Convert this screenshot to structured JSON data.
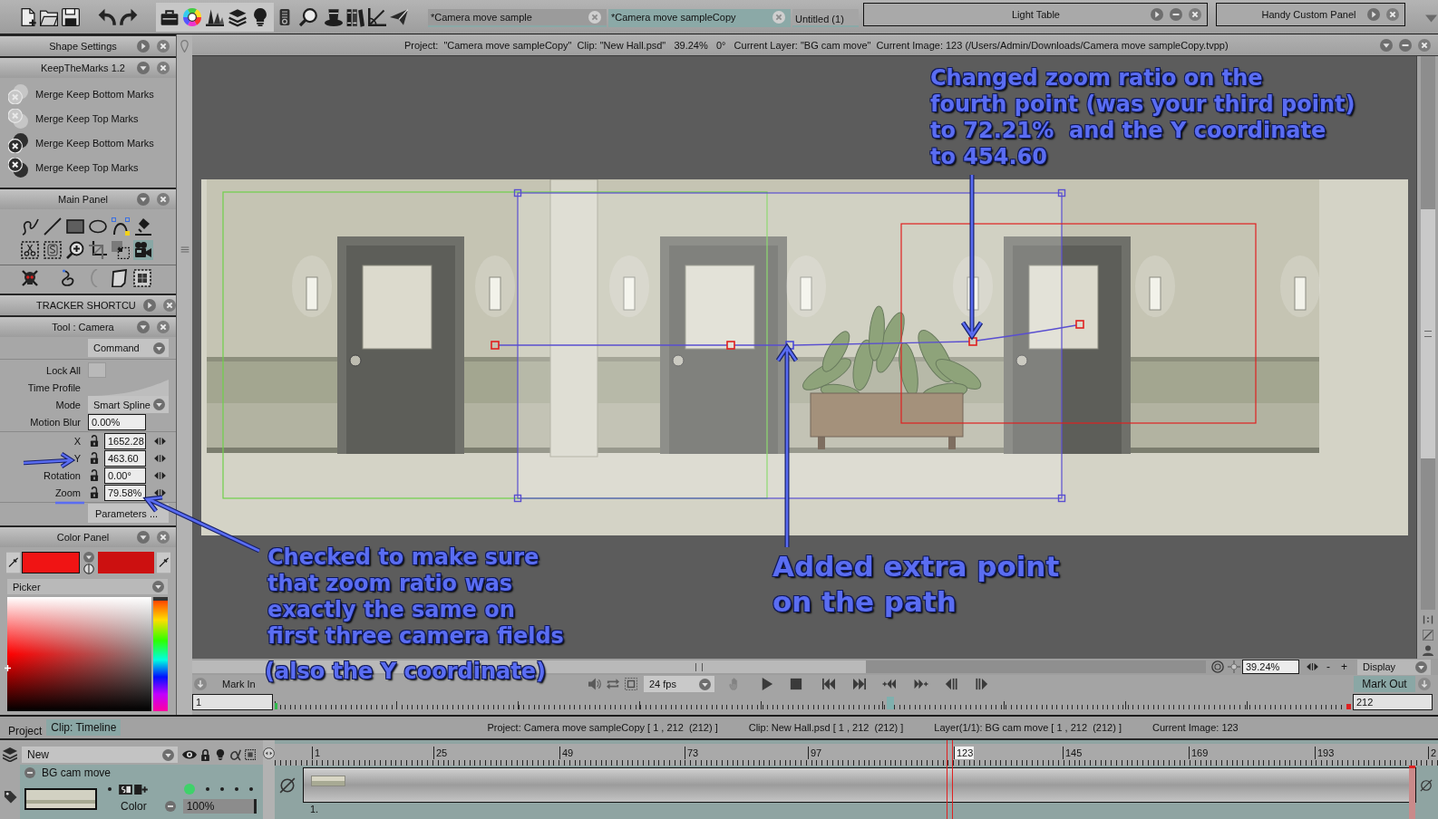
{
  "toolbar": {
    "document_tabs": [
      {
        "label": "*Camera move sample",
        "selected": false,
        "closable": true
      },
      {
        "label": "*Camera move sampleCopy",
        "selected": true,
        "closable": true
      },
      {
        "label": "Untitled (1)",
        "selected": false,
        "closable": false
      }
    ],
    "panels": [
      {
        "title": "Light Table",
        "expanded": false,
        "minimizable": true
      },
      {
        "title": "Handy Custom Panel",
        "expanded": false,
        "minimizable": false
      }
    ]
  },
  "info_bar": {
    "text": "Project:  \"Camera move sampleCopy\"  Clip: \"New Hall.psd\"   39.24%   0°   Current Layer: \"BG cam move\"  Current Image: 123 (/Users/Admin/Downloads/Camera move sampleCopy.tvpp)"
  },
  "side_panels": {
    "shape_settings": {
      "title": "Shape Settings",
      "expanded": false
    },
    "keep_the_marks": {
      "title": "KeepTheMarks 1.2",
      "expanded": true,
      "items": [
        {
          "label": "Merge Keep Bottom Marks",
          "kind": "keep_bottom",
          "disabled": true
        },
        {
          "label": "Merge Keep Top Marks",
          "kind": "keep_top",
          "disabled": true
        },
        {
          "label": "Merge Keep Bottom Marks",
          "kind": "keep_bottom",
          "disabled": false
        },
        {
          "label": "Merge Keep Top Marks",
          "kind": "keep_top",
          "disabled": false
        }
      ]
    },
    "main_panel": {
      "title": "Main Panel",
      "expanded": true,
      "tool_rows": [
        [
          {
            "kind": "freehand",
            "selected": false
          },
          {
            "kind": "line",
            "selected": false
          },
          {
            "kind": "rectangle",
            "selected": false
          },
          {
            "kind": "ellipse",
            "selected": false
          },
          {
            "kind": "spline",
            "selected": false
          },
          {
            "kind": "ink",
            "selected": false
          }
        ],
        [
          {
            "kind": "cut",
            "selected": false
          },
          {
            "kind": "stencil",
            "selected": false
          },
          {
            "kind": "zoom",
            "selected": false
          },
          {
            "kind": "crop",
            "selected": false
          },
          {
            "kind": "transform",
            "selected": false
          },
          {
            "kind": "camera",
            "selected": true
          }
        ],
        [
          {
            "kind": "skull",
            "selected": false
          },
          {
            "kind": "curl",
            "selected": false
          },
          {
            "kind": "bracket",
            "selected": false
          },
          {
            "kind": "page",
            "selected": false
          },
          {
            "kind": "stamp",
            "selected": false
          }
        ]
      ]
    },
    "tracker_shortcut": {
      "title": "TRACKER SHORTCU",
      "expanded": false
    },
    "camera_tool": {
      "title": "Tool : Camera",
      "expanded": true,
      "command": "Command",
      "lock_all": {
        "label": "Lock All",
        "checked": false
      },
      "time_profile": {
        "label": "Time Profile"
      },
      "mode": {
        "label": "Mode",
        "value": "Smart Spline"
      },
      "motion_blur": {
        "label": "Motion Blur",
        "value": "0.00%"
      },
      "fields": [
        {
          "label": "X",
          "value": "1652.28",
          "locked": false
        },
        {
          "label": "Y",
          "value": "463.60",
          "locked": false
        },
        {
          "label": "Rotation",
          "value": "0.00°",
          "locked": false
        },
        {
          "label": "Zoom",
          "value": "79.58%",
          "locked": false
        }
      ],
      "parameters": "Parameters ..."
    },
    "color_panel": {
      "title": "Color Panel",
      "expanded": true,
      "swatches": [
        {
          "color": "#f01414"
        },
        {
          "color": "#cc1010"
        }
      ],
      "mode": "Picker",
      "hue_slider": {
        "level": 0
      }
    }
  },
  "canvas": {
    "annotations": [
      {
        "text": "Changed zoom ratio on the\nfourth point (was your third point)\nto 72.21%  and the Y coordinate\nto 454.60"
      },
      {
        "text": "Checked to make sure\nthat zoom ratio was\nexactly the same on\nfirst three camera fields"
      },
      {
        "text": "Added extra point\non the path"
      },
      {
        "text": "(also the Y coordinate)"
      }
    ]
  },
  "view_controls": {
    "zoom": "39.24%",
    "zoom_out": "-",
    "zoom_in": "+",
    "display": "Display",
    "mark_in": "Mark In",
    "fps": "24 fps",
    "mark_out": "Mark Out",
    "first_frame": "1",
    "last_frame": "212"
  },
  "timeline": {
    "tabs": [
      {
        "label": "Project",
        "selected": false
      },
      {
        "label": "Clip: Timeline",
        "selected": true
      }
    ],
    "status": [
      "Project: Camera move sampleCopy [ 1 , 212  (212) ]",
      "Clip: New Hall.psd [ 1 , 212  (212) ]",
      "Layer(1/1): BG cam move [ 1 , 212  (212) ]",
      "Current Image: 123"
    ],
    "layer_set": "New",
    "layer": {
      "name": "BG cam move",
      "selected": true,
      "blend_mode": "Color",
      "opacity": {
        "value": "100%",
        "level": 1
      }
    },
    "ruler": [
      {
        "label": "1",
        "current": false
      },
      {
        "label": "25",
        "current": false
      },
      {
        "label": "49",
        "current": false
      },
      {
        "label": "73",
        "current": false
      },
      {
        "label": "97",
        "current": false
      },
      {
        "label": "123",
        "current": true
      },
      {
        "label": "145",
        "current": false
      },
      {
        "label": "169",
        "current": false
      },
      {
        "label": "193",
        "current": false
      },
      {
        "label": "2",
        "current": false
      }
    ],
    "start_mark": "1."
  }
}
